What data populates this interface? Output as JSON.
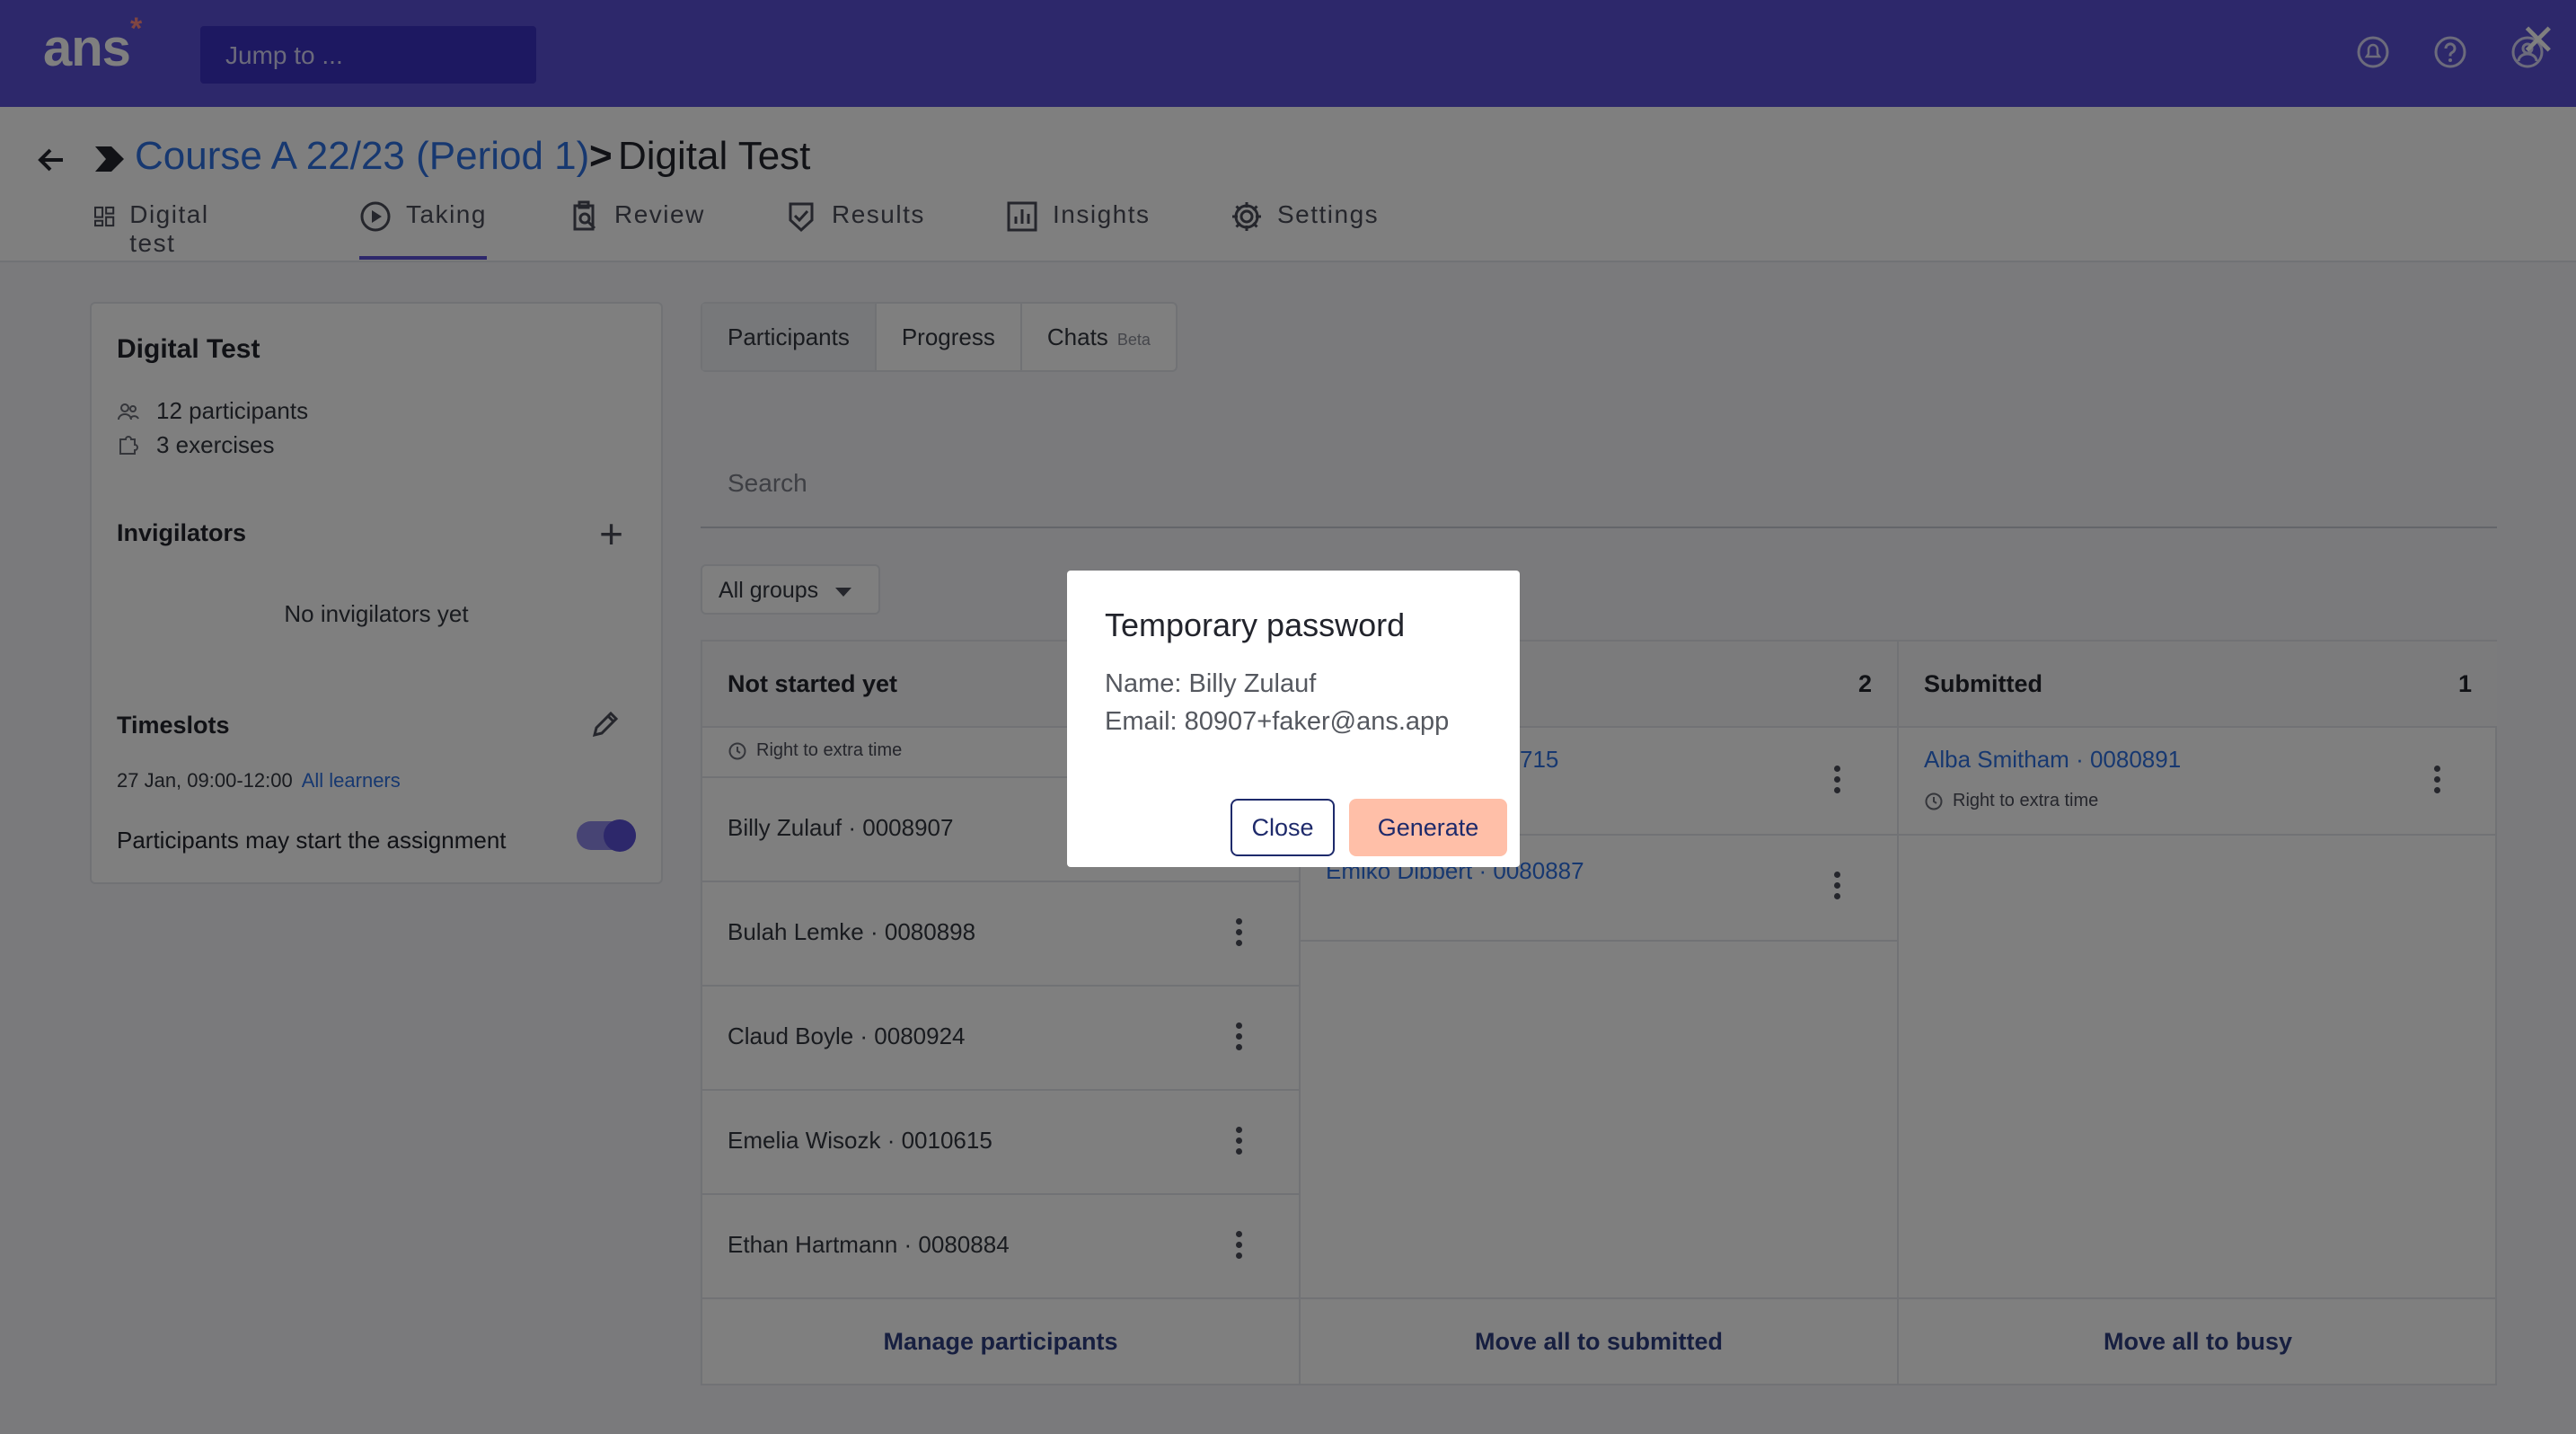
{
  "topbar": {
    "logo": "ans",
    "logo_mark": "*",
    "jump_placeholder": "Jump to ...",
    "icons": [
      "notifications-icon",
      "help-icon",
      "account-icon"
    ],
    "close_glyph": "✕"
  },
  "breadcrumb": {
    "course": "Course A 22/23 (Period 1)",
    "separator": ">",
    "current": "Digital Test"
  },
  "tabs": [
    {
      "label": "Digital test",
      "icon": "dashboard-icon"
    },
    {
      "label": "Taking",
      "icon": "play-icon",
      "active": true
    },
    {
      "label": "Review",
      "icon": "review-icon"
    },
    {
      "label": "Results",
      "icon": "results-icon"
    },
    {
      "label": "Insights",
      "icon": "insights-icon"
    },
    {
      "label": "Settings",
      "icon": "gear-icon"
    }
  ],
  "sidebar": {
    "title": "Digital Test",
    "participants": "12 participants",
    "exercises": "3 exercises",
    "invigilators_title": "Invigilators",
    "no_invigilators": "No invigilators yet",
    "timeslots_title": "Timeslots",
    "timeslot_time": "27 Jan, 09:00-12:00",
    "timeslot_group": "All learners",
    "toggle_label": "Participants may start the assignment",
    "toggle_on": true
  },
  "subtabs": {
    "participants": "Participants",
    "progress": "Progress",
    "chats": "Chats",
    "beta": "Beta"
  },
  "search": {
    "placeholder": "Search"
  },
  "groups_filter": {
    "selected": "All groups"
  },
  "columns": {
    "not_started": {
      "title": "Not started yet",
      "extra": "Right to extra time",
      "rows": [
        "Billy Zulauf · 0008907",
        "Bulah Lemke · 0080898",
        "Claud Boyle · 0080924",
        "Emelia Wisozk · 0010615",
        "Ethan Hartmann · 0080884"
      ],
      "footer": "Manage participants"
    },
    "busy": {
      "count": "2",
      "rows": [
        "715",
        "Emiko Dibbert · 0080887"
      ],
      "footer": "Move all to submitted"
    },
    "submitted": {
      "title": "Submitted",
      "count": "1",
      "rows": [
        "Alba Smitham · 0080891"
      ],
      "extra": "Right to extra time",
      "footer": "Move all to busy"
    }
  },
  "modal": {
    "title": "Temporary password",
    "name_line": "Name: Billy Zulauf",
    "email_line": "Email: 80907+faker@ans.app",
    "close_label": "Close",
    "generate_label": "Generate"
  },
  "colors": {
    "brand": "#5a50d6",
    "link": "#2e70e0",
    "generate_button": "#ffbfa8",
    "overlay": "rgba(0,0,0,0.5)"
  }
}
